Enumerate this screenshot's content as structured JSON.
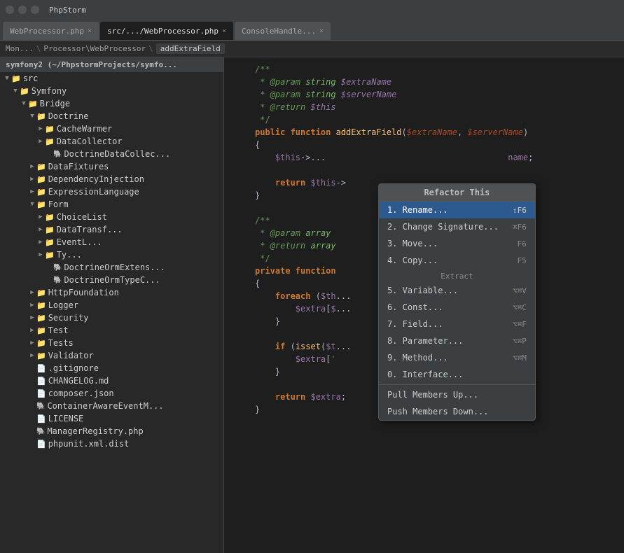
{
  "titleBar": {
    "title": "PhpStorm"
  },
  "tabs": [
    {
      "label": "WebProcessor.php",
      "active": false
    },
    {
      "label": "src/.../WebProcessor.php",
      "active": true
    },
    {
      "label": "ConsoleHandle...",
      "active": false
    }
  ],
  "breadcrumbs": [
    {
      "label": "Mon..."
    },
    {
      "label": "Processor\\WebProcessor"
    },
    {
      "label": "addExtraField",
      "active": true
    }
  ],
  "sidebar": {
    "header": "symfony2 (~/PhpstormProjects/symfo...",
    "tree": [
      {
        "level": 0,
        "type": "folder",
        "expanded": true,
        "label": "src"
      },
      {
        "level": 1,
        "type": "folder",
        "expanded": true,
        "label": "Symfony"
      },
      {
        "level": 2,
        "type": "folder",
        "expanded": true,
        "label": "Bridge"
      },
      {
        "level": 3,
        "type": "folder",
        "expanded": true,
        "label": "Doctrine"
      },
      {
        "level": 4,
        "type": "folder",
        "expanded": true,
        "label": "CacheWarmer"
      },
      {
        "level": 4,
        "type": "folder",
        "expanded": true,
        "label": "DataCollector"
      },
      {
        "level": 4,
        "type": "phpfile",
        "label": "DoctrineDataCollec..."
      },
      {
        "level": 3,
        "type": "folder",
        "expanded": false,
        "label": "DataFixtures"
      },
      {
        "level": 3,
        "type": "folder",
        "expanded": false,
        "label": "DependencyInjection"
      },
      {
        "level": 3,
        "type": "folder",
        "expanded": false,
        "label": "ExpressionLanguage"
      },
      {
        "level": 3,
        "type": "folder",
        "expanded": true,
        "label": "Form"
      },
      {
        "level": 4,
        "type": "folder",
        "expanded": false,
        "label": "ChoiceList"
      },
      {
        "level": 4,
        "type": "folder",
        "expanded": false,
        "label": "DataTransf..."
      },
      {
        "level": 4,
        "type": "folder",
        "expanded": false,
        "label": "EventL..."
      },
      {
        "level": 4,
        "type": "folder",
        "expanded": false,
        "label": "Ty..."
      },
      {
        "level": 4,
        "type": "phpfile",
        "label": "DoctrineOrmExtens..."
      },
      {
        "level": 4,
        "type": "phpfile",
        "label": "DoctrineOrmTypeC..."
      },
      {
        "level": 3,
        "type": "folder",
        "expanded": false,
        "label": "HttpFoundation"
      },
      {
        "level": 3,
        "type": "folder",
        "expanded": false,
        "label": "Logger"
      },
      {
        "level": 3,
        "type": "folder",
        "expanded": false,
        "label": "Security"
      },
      {
        "level": 3,
        "type": "folder",
        "expanded": false,
        "label": "Test"
      },
      {
        "level": 3,
        "type": "folder",
        "expanded": false,
        "label": "Tests"
      },
      {
        "level": 3,
        "type": "folder",
        "expanded": false,
        "label": "Validator"
      },
      {
        "level": 3,
        "type": "file",
        "label": ".gitignore"
      },
      {
        "level": 3,
        "type": "file",
        "label": "CHANGELOG.md"
      },
      {
        "level": 3,
        "type": "file",
        "label": "composer.json"
      },
      {
        "level": 3,
        "type": "phpfile",
        "label": "ContainerAwareEventM..."
      },
      {
        "level": 3,
        "type": "file",
        "label": "LICENSE"
      },
      {
        "level": 3,
        "type": "phpfile",
        "label": "ManagerRegistry.php"
      },
      {
        "level": 3,
        "type": "file",
        "label": "phpunit.xml.dist"
      }
    ]
  },
  "contextMenu": {
    "header": "Refactor This",
    "items": [
      {
        "label": "1. Rename...",
        "shortcut": "⇧F6",
        "highlighted": true
      },
      {
        "label": "2. Change Signature...",
        "shortcut": "⌘F6"
      },
      {
        "label": "3. Move...",
        "shortcut": "F6"
      },
      {
        "label": "4. Copy...",
        "shortcut": "F5"
      },
      {
        "sectionLabel": "Extract"
      },
      {
        "label": "5. Variable...",
        "shortcut": "⌥⌘V"
      },
      {
        "label": "6. Const...",
        "shortcut": "⌥⌘C"
      },
      {
        "label": "7. Field...",
        "shortcut": "⌥⌘F"
      },
      {
        "label": "8. Parameter...",
        "shortcut": "⌥⌘P"
      },
      {
        "label": "9. Method...",
        "shortcut": "⌥⌘M"
      },
      {
        "label": "0. Interface...",
        "shortcut": ""
      },
      {
        "separator": true
      },
      {
        "label": "Pull Members Up...",
        "shortcut": ""
      },
      {
        "label": "Push Members Down...",
        "shortcut": ""
      }
    ]
  },
  "codeLines": [
    {
      "num": "",
      "content": "/**"
    },
    {
      "num": "",
      "content": " * @param string $extraName"
    },
    {
      "num": "",
      "content": " * @param string $serverName"
    },
    {
      "num": "",
      "content": " * @return $this"
    },
    {
      "num": "",
      "content": " */"
    },
    {
      "num": "",
      "content": "public function addExtraField($extraName, $serverName)"
    },
    {
      "num": "",
      "content": "{"
    },
    {
      "num": "",
      "content": "    $this->...                                    name;"
    },
    {
      "num": "",
      "content": ""
    },
    {
      "num": "",
      "content": "    return $this->"
    },
    {
      "num": "",
      "content": "}"
    },
    {
      "num": "",
      "content": ""
    },
    {
      "num": "",
      "content": "/**"
    },
    {
      "num": "",
      "content": " * @param array"
    },
    {
      "num": "",
      "content": " * @return array"
    },
    {
      "num": "",
      "content": " */"
    },
    {
      "num": "",
      "content": "private function"
    },
    {
      "num": "",
      "content": "{"
    },
    {
      "num": "",
      "content": "    foreach ($th...                     => $serve"
    },
    {
      "num": "",
      "content": "        $extra[$...                     verData[$s"
    },
    {
      "num": "",
      "content": "    }"
    },
    {
      "num": "",
      "content": ""
    },
    {
      "num": "",
      "content": "    if (isset($t..."
    },
    {
      "num": "",
      "content": "        $extra['                     data['UNIQU"
    },
    {
      "num": "",
      "content": "    }"
    },
    {
      "num": "",
      "content": ""
    },
    {
      "num": "",
      "content": "    return $extra;"
    },
    {
      "num": "",
      "content": "}"
    }
  ]
}
